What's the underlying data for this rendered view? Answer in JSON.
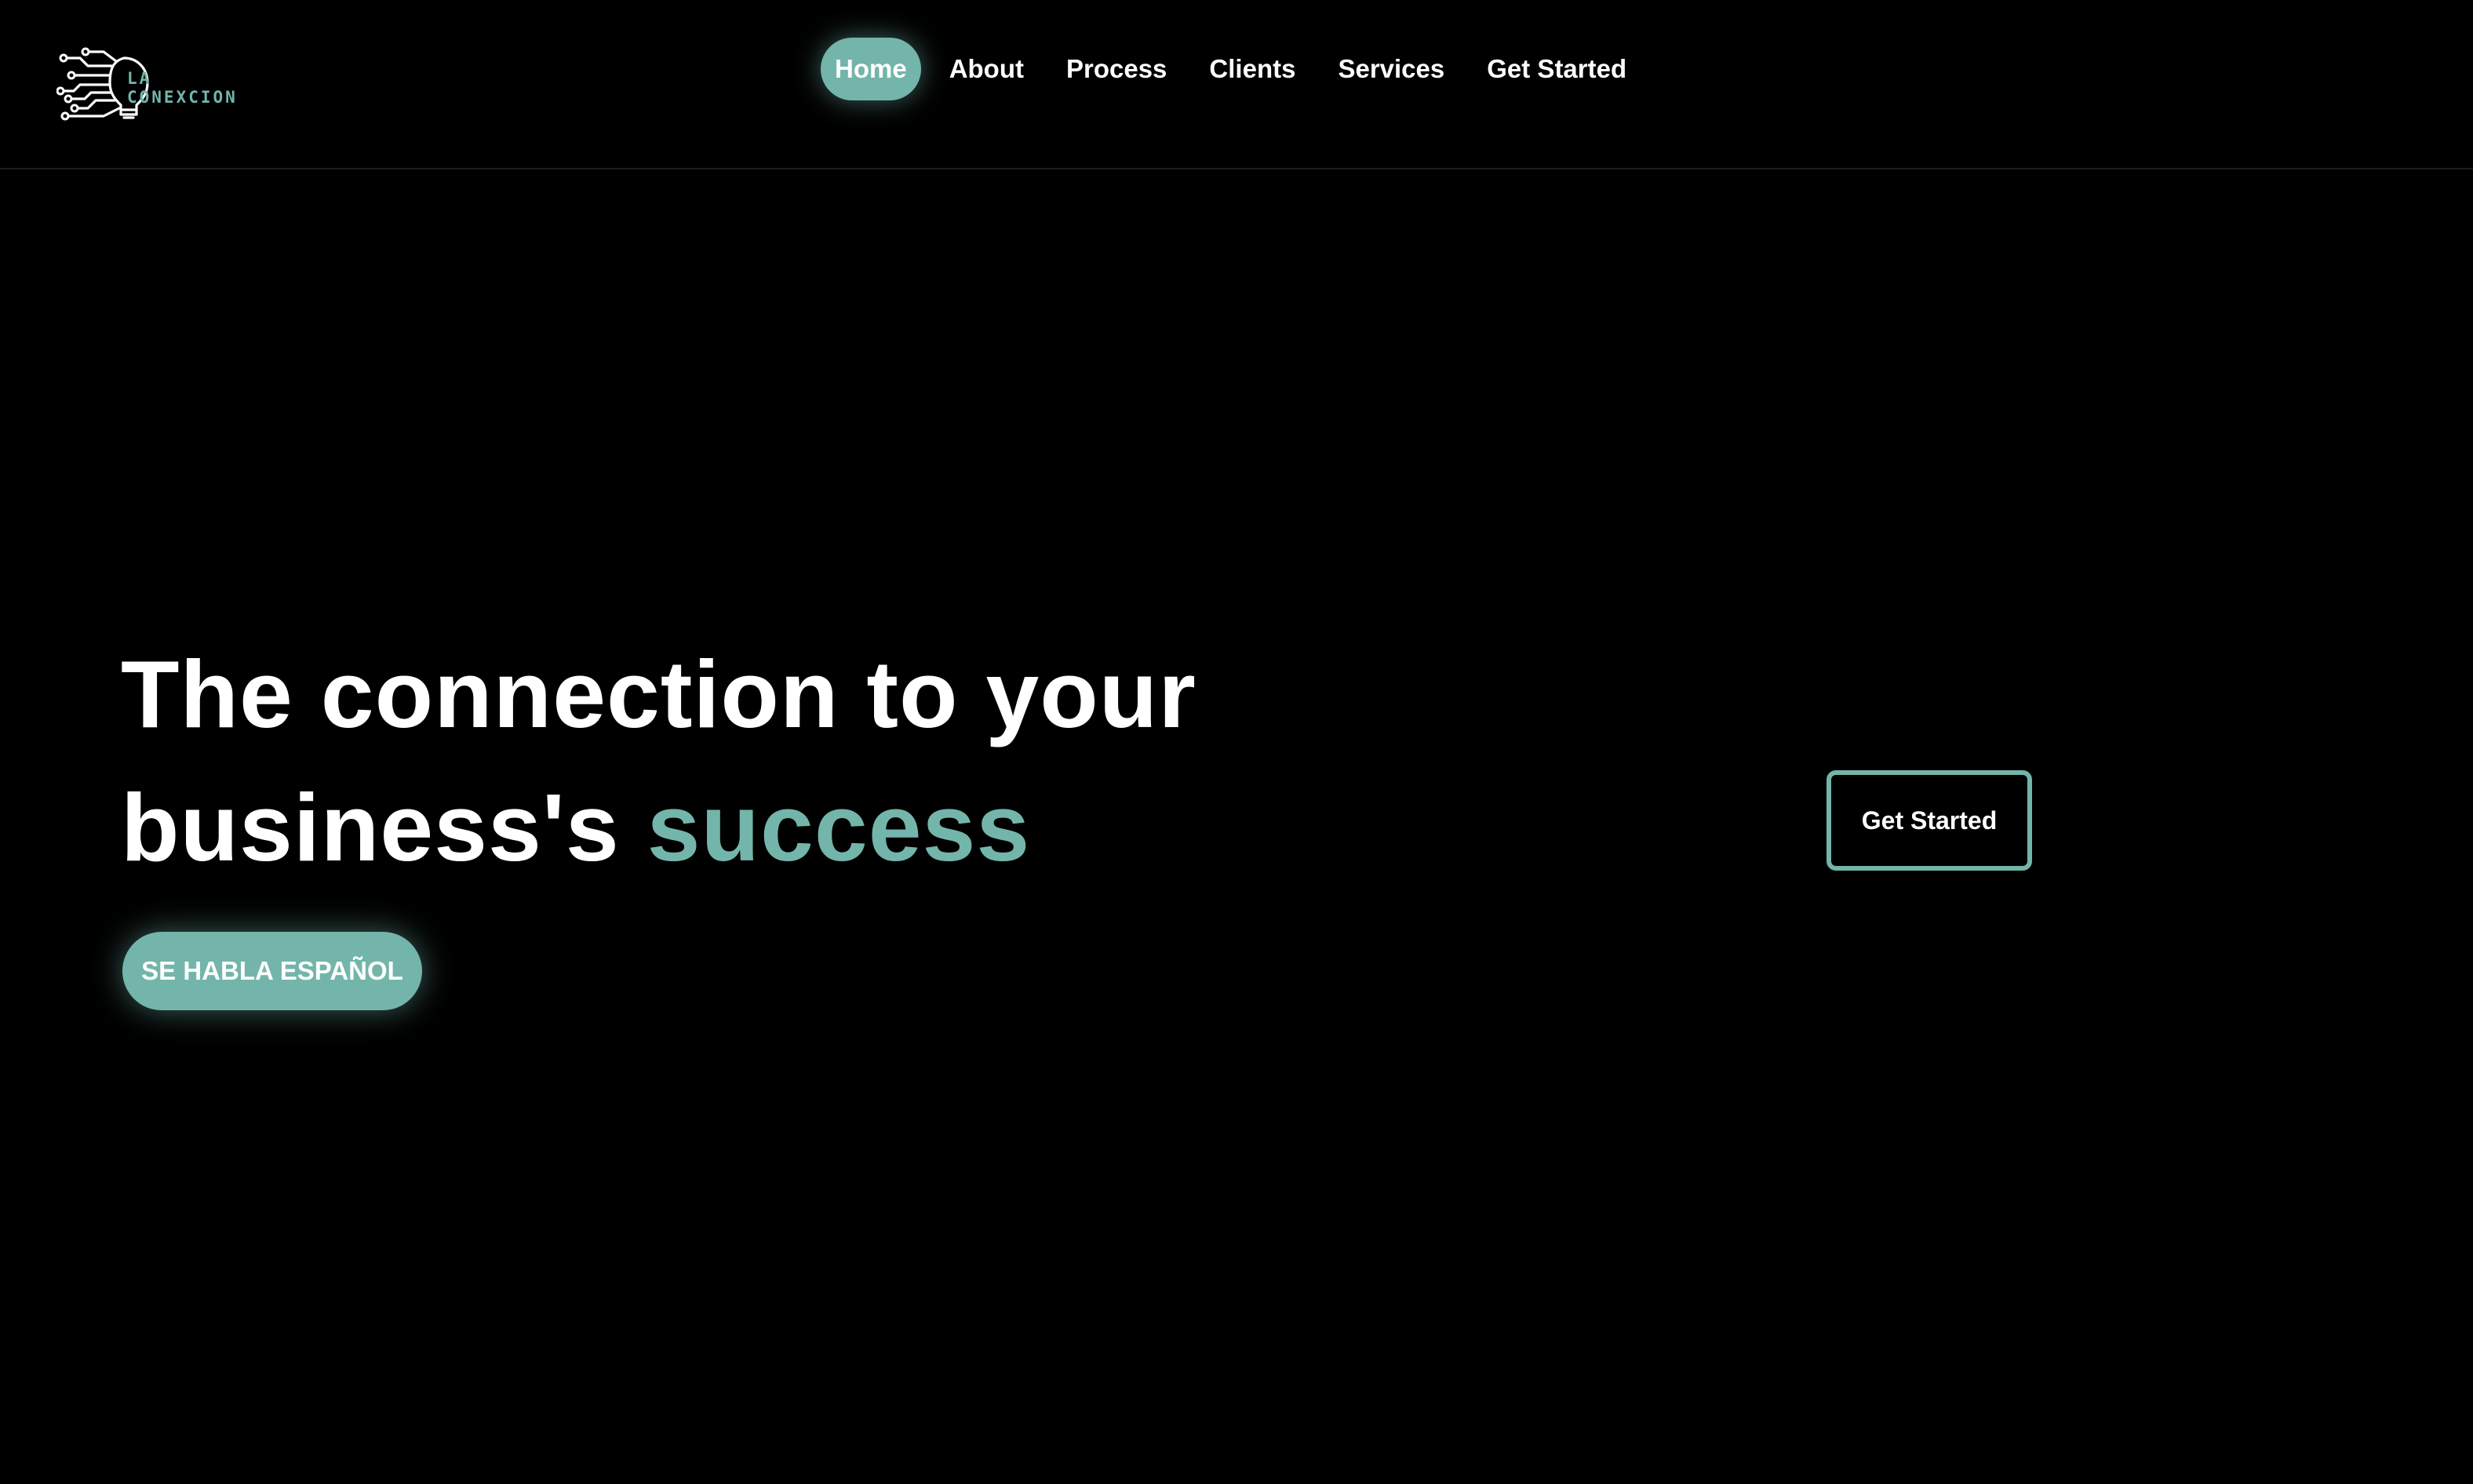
{
  "brand": {
    "line1": "LA",
    "line2": "CONEXCION",
    "icon": "circuit-lightbulb-icon",
    "color": "#73b5aa"
  },
  "nav": {
    "items": [
      {
        "label": "Home",
        "active": true
      },
      {
        "label": "About",
        "active": false
      },
      {
        "label": "Process",
        "active": false
      },
      {
        "label": "Clients",
        "active": false
      },
      {
        "label": "Services",
        "active": false
      },
      {
        "label": "Get Started",
        "active": false
      }
    ]
  },
  "hero": {
    "title_line1": "The connection to your",
    "title_line2_prefix": "business's ",
    "title_accent": "success",
    "spanish_button": "SE HABLA ESPAÑOL",
    "cta_button": "Get Started"
  },
  "colors": {
    "background": "#000000",
    "accent": "#73b5aa",
    "text": "#ffffff"
  }
}
